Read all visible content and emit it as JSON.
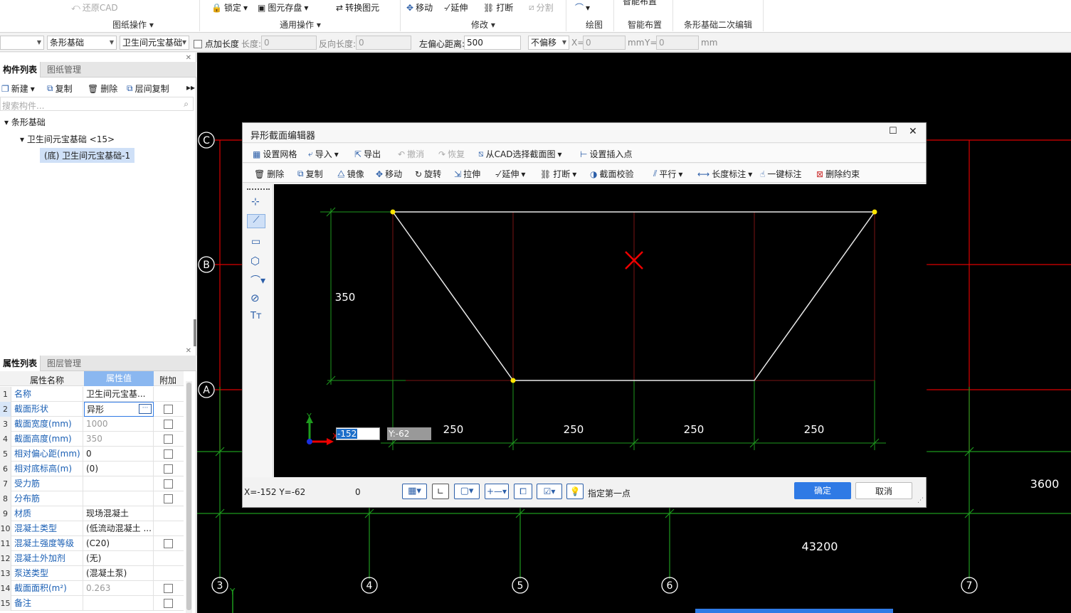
{
  "ribbon": {
    "items": [
      "还原CAD",
      "锁定",
      "图元存盘",
      "转换图元",
      "移动",
      "延伸",
      "打断",
      "分割"
    ],
    "groups": [
      "图纸操作",
      "通用操作",
      "修改",
      "绘图",
      "智能布置",
      "条形基础二次编辑"
    ],
    "top_partial": "智能布置"
  },
  "toolbar2": {
    "floor_select": "",
    "type_select": "条形基础",
    "component_select": "卫生间元宝基础",
    "point_length_label": "点加长度",
    "length_label": "长度:",
    "length_value": "0",
    "reverse_length_label": "反向长度:",
    "reverse_length_value": "0",
    "left_offset_label": "左偏心距离:",
    "left_offset_value": "500",
    "offset_mode": "不偏移",
    "x_label": "X=",
    "x_value": "0",
    "mm1": "mm",
    "y_label": "Y=",
    "y_value": "0",
    "mm2": "mm"
  },
  "component_panel": {
    "tabs": [
      "构件列表",
      "图纸管理"
    ],
    "actions": [
      "新建",
      "复制",
      "删除",
      "层间复制"
    ],
    "search_placeholder": "搜索构件...",
    "tree": {
      "root": "条形基础",
      "child": "卫生间元宝基础 <15>",
      "leaf": "(底) 卫生间元宝基础-1"
    }
  },
  "property_panel": {
    "tabs": [
      "属性列表",
      "图层管理"
    ],
    "headers": [
      "属性名称",
      "属性值",
      "附加"
    ],
    "rows": [
      {
        "n": "1",
        "k": "名称",
        "v": "卫生间元宝基..."
      },
      {
        "n": "2",
        "k": "截面形状",
        "v": "异形"
      },
      {
        "n": "3",
        "k": "截面宽度(mm)",
        "v": "1000"
      },
      {
        "n": "4",
        "k": "截面高度(mm)",
        "v": "350"
      },
      {
        "n": "5",
        "k": "相对偏心距(mm)",
        "v": "0"
      },
      {
        "n": "6",
        "k": "相对底标高(m)",
        "v": "(0)"
      },
      {
        "n": "7",
        "k": "受力筋",
        "v": ""
      },
      {
        "n": "8",
        "k": "分布筋",
        "v": ""
      },
      {
        "n": "9",
        "k": "材质",
        "v": "现场混凝土"
      },
      {
        "n": "10",
        "k": "混凝土类型",
        "v": "(低流动混凝土 ..."
      },
      {
        "n": "11",
        "k": "混凝土强度等级",
        "v": "(C20)"
      },
      {
        "n": "12",
        "k": "混凝土外加剂",
        "v": "(无)"
      },
      {
        "n": "13",
        "k": "泵送类型",
        "v": "(混凝土泵)"
      },
      {
        "n": "14",
        "k": "截面面积(m²)",
        "v": "0.263"
      },
      {
        "n": "15",
        "k": "备注",
        "v": ""
      }
    ]
  },
  "canvas": {
    "axis_rows": [
      "C",
      "B",
      "A"
    ],
    "axis_cols": [
      "3",
      "4",
      "5",
      "6",
      "7"
    ],
    "dims": [
      "3600",
      "43200"
    ]
  },
  "dialog": {
    "title": "异形截面编辑器",
    "toolbar1": [
      "设置网格",
      "导入",
      "导出",
      "撤消",
      "恢复",
      "从CAD选择截面图",
      "设置插入点"
    ],
    "toolbar2": [
      "删除",
      "复制",
      "镜像",
      "移动",
      "旋转",
      "拉伸",
      "延伸",
      "打断",
      "截面校验",
      "平行",
      "长度标注",
      "一键标注",
      "删除约束"
    ],
    "height_dim": "350",
    "width_dims": [
      "250",
      "250",
      "250",
      "250"
    ],
    "x_input": "-152",
    "y_input": "Y:-62",
    "status_coords": "X=-152 Y=-62",
    "status_zero": "0",
    "prompt": "指定第一点",
    "ok": "确定",
    "cancel": "取消",
    "colors": {
      "accent": "#2f7ae5",
      "grid_green": "#1e9a1e",
      "grid_red": "#b01010"
    }
  }
}
